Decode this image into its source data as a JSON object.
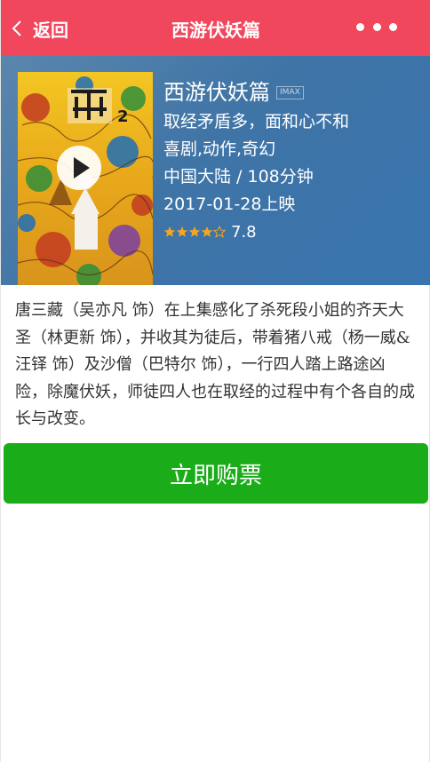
{
  "header": {
    "back_label": "返回",
    "title": "西游伏妖篇",
    "more_icon": "more-dots-icon"
  },
  "movie": {
    "name": "西游伏妖篇",
    "format_badge": "IMAX",
    "tagline": "取经矛盾多，面和心不和",
    "genres": "喜剧,动作,奇幻",
    "region_duration": "中国大陆 / 108分钟",
    "release": "2017-01-28上映",
    "rating": "7.8",
    "stars_filled": 4,
    "stars_total": 5,
    "star_color": "#f5a623"
  },
  "description": "唐三藏（吴亦凡 饰）在上集感化了杀死段小姐的齐天大圣（林更新 饰），并收其为徒后，带着猪八戒（杨一威&汪铎 饰）及沙僧（巴特尔 饰），一行四人踏上路途凶险，除魔伏妖，师徒四人也在取经的过程中有个各自的成长与改变。",
  "buy_button": "立即购票",
  "colors": {
    "header": "#f1475d",
    "panel": "#3f74a6",
    "buy": "#1aac19"
  }
}
